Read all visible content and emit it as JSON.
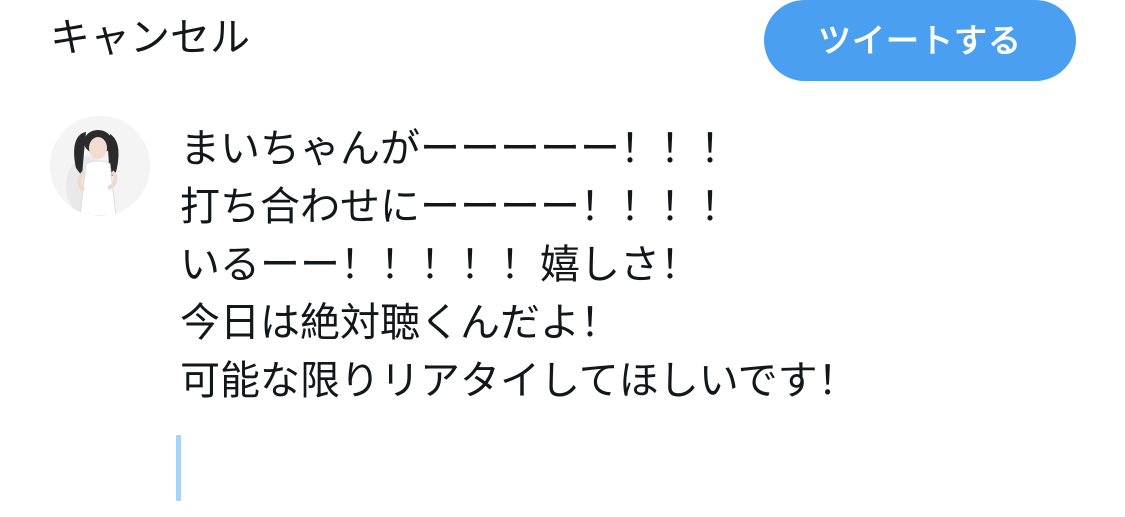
{
  "header": {
    "cancel_label": "キャンセル",
    "tweet_button_label": "ツイートする"
  },
  "composer": {
    "lines": [
      "まいちゃんがーーーーー！！！",
      "打ち合わせにーーーー！！！！",
      "いるーー！！！！！嬉しさ！",
      "今日は絶対聴くんだよ！",
      "可能な限りリアタイしてほしいです！"
    ]
  },
  "colors": {
    "accent": "#4a9ff0",
    "text": "#14171a",
    "caret": "#a9d2f6"
  }
}
